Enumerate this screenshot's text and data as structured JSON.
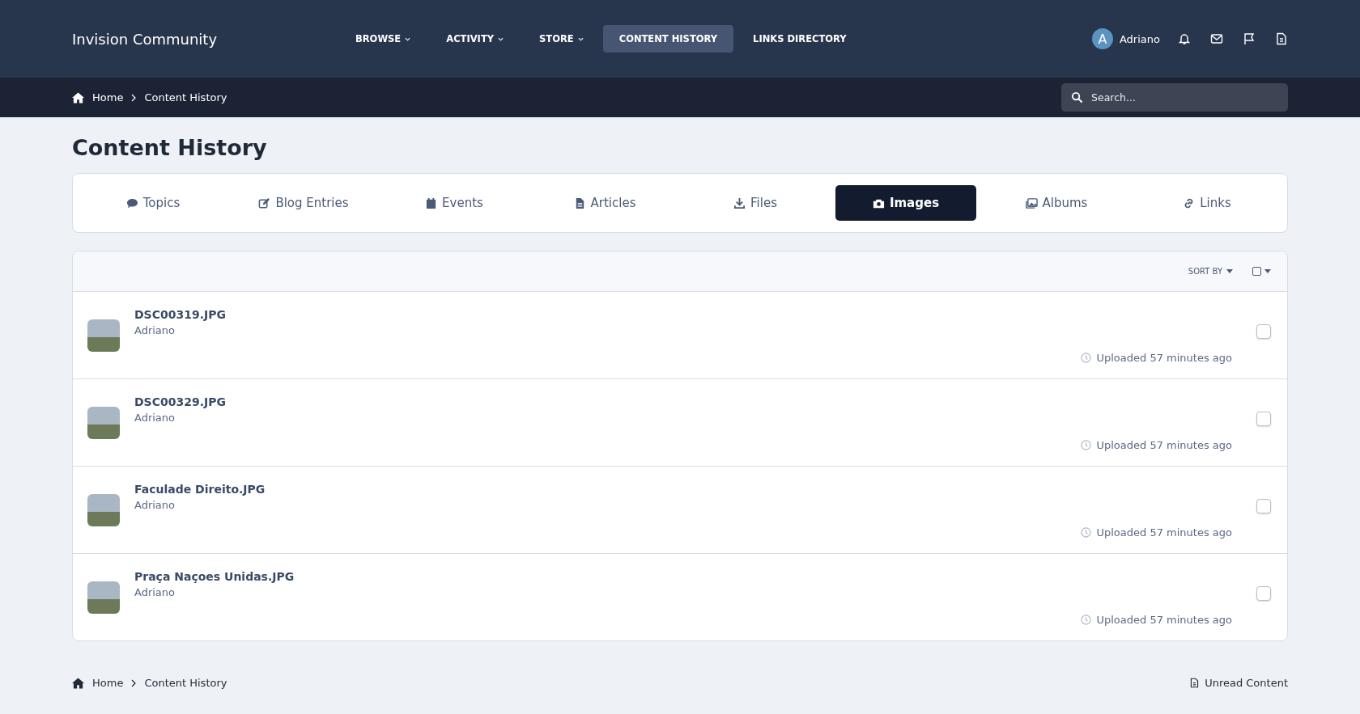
{
  "site_title": "Invision Community",
  "nav": [
    {
      "label": "BROWSE",
      "dropdown": true,
      "selected": false
    },
    {
      "label": "ACTIVITY",
      "dropdown": true,
      "selected": false
    },
    {
      "label": "STORE",
      "dropdown": true,
      "selected": false
    },
    {
      "label": "CONTENT HISTORY",
      "dropdown": false,
      "selected": true
    },
    {
      "label": "LINKS DIRECTORY",
      "dropdown": false,
      "selected": false
    }
  ],
  "user": {
    "initial": "A",
    "name": "Adriano"
  },
  "breadcrumb": [
    "Home",
    "Content History"
  ],
  "search": {
    "placeholder": "Search..."
  },
  "page_title": "Content History",
  "tabs": [
    {
      "label": "Topics",
      "selected": false
    },
    {
      "label": "Blog Entries",
      "selected": false
    },
    {
      "label": "Events",
      "selected": false
    },
    {
      "label": "Articles",
      "selected": false
    },
    {
      "label": "Files",
      "selected": false
    },
    {
      "label": "Images",
      "selected": true
    },
    {
      "label": "Albums",
      "selected": false
    },
    {
      "label": "Links",
      "selected": false
    }
  ],
  "sort_label": "SORT BY",
  "items": [
    {
      "title": "DSC00319.JPG",
      "author": "Adriano",
      "time": "Uploaded 57 minutes ago",
      "checked": false
    },
    {
      "title": "DSC00329.JPG",
      "author": "Adriano",
      "time": "Uploaded 57 minutes ago",
      "checked": false
    },
    {
      "title": "Faculade Direito.JPG",
      "author": "Adriano",
      "time": "Uploaded 57 minutes ago",
      "checked": false
    },
    {
      "title": "Praça Naçoes Unidas.JPG",
      "author": "Adriano",
      "time": "Uploaded 57 minutes ago",
      "checked": false
    }
  ],
  "footer_breadcrumb": [
    "Home",
    "Content History"
  ],
  "footer_link": "Unread Content"
}
